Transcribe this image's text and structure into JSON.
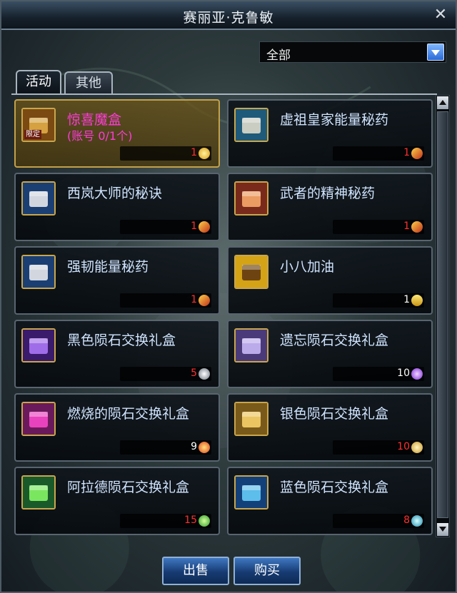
{
  "window": {
    "title": "赛丽亚·克鲁敏"
  },
  "filter": {
    "selected": "全部"
  },
  "tabs": [
    {
      "label": "活动",
      "active": true
    },
    {
      "label": "其他",
      "active": false
    }
  ],
  "items": [
    {
      "name": "惊喜魔盒",
      "sub": "(账号 0/1个)",
      "badge": "限定",
      "price": "1",
      "currency": "gold-coin-icon",
      "icon": "mystery-box-icon",
      "selected": true
    },
    {
      "name": "虚祖皇家能量秘药",
      "price": "1",
      "currency": "ticket-icon",
      "icon": "potion-bottle-icon"
    },
    {
      "name": "西岚大师的秘诀",
      "price": "1",
      "currency": "ticket-icon",
      "icon": "potion-flask-icon"
    },
    {
      "name": "武者的精神秘药",
      "price": "1",
      "currency": "ticket-icon",
      "icon": "spirit-orb-icon"
    },
    {
      "name": "强韧能量秘药",
      "price": "1",
      "currency": "ticket-icon",
      "icon": "potion-flask-icon"
    },
    {
      "name": "小八加油",
      "price": "1",
      "currency": "gold-bars-icon",
      "icon": "heart-card-icon"
    },
    {
      "name": "黑色陨石交换礼盒",
      "price": "5",
      "currency": "silver-gem-icon",
      "icon": "purple-chest-icon"
    },
    {
      "name": "遗忘陨石交换礼盒",
      "price": "10",
      "currency": "purple-gem-icon",
      "icon": "violet-chest-icon"
    },
    {
      "name": "燃烧的陨石交换礼盒",
      "price": "9",
      "currency": "fire-gem-icon",
      "icon": "magenta-chest-icon"
    },
    {
      "name": "银色陨石交换礼盒",
      "price": "10",
      "currency": "gold-gem-icon",
      "icon": "gold-chest-icon"
    },
    {
      "name": "阿拉德陨石交换礼盒",
      "price": "15",
      "currency": "green-gem-icon",
      "icon": "green-chest-icon"
    },
    {
      "name": "蓝色陨石交换礼盒",
      "price": "8",
      "currency": "cyan-gem-icon",
      "icon": "blue-chest-icon"
    }
  ],
  "buttons": {
    "sell": "出售",
    "buy": "购买"
  },
  "colors": {
    "accent_blue": "#2b6ad6",
    "price_red": "#ff2f2f",
    "name_blue": "#cfe3ff",
    "selected_magenta": "#ff3bd6",
    "gold_border": "#c9a64d"
  }
}
